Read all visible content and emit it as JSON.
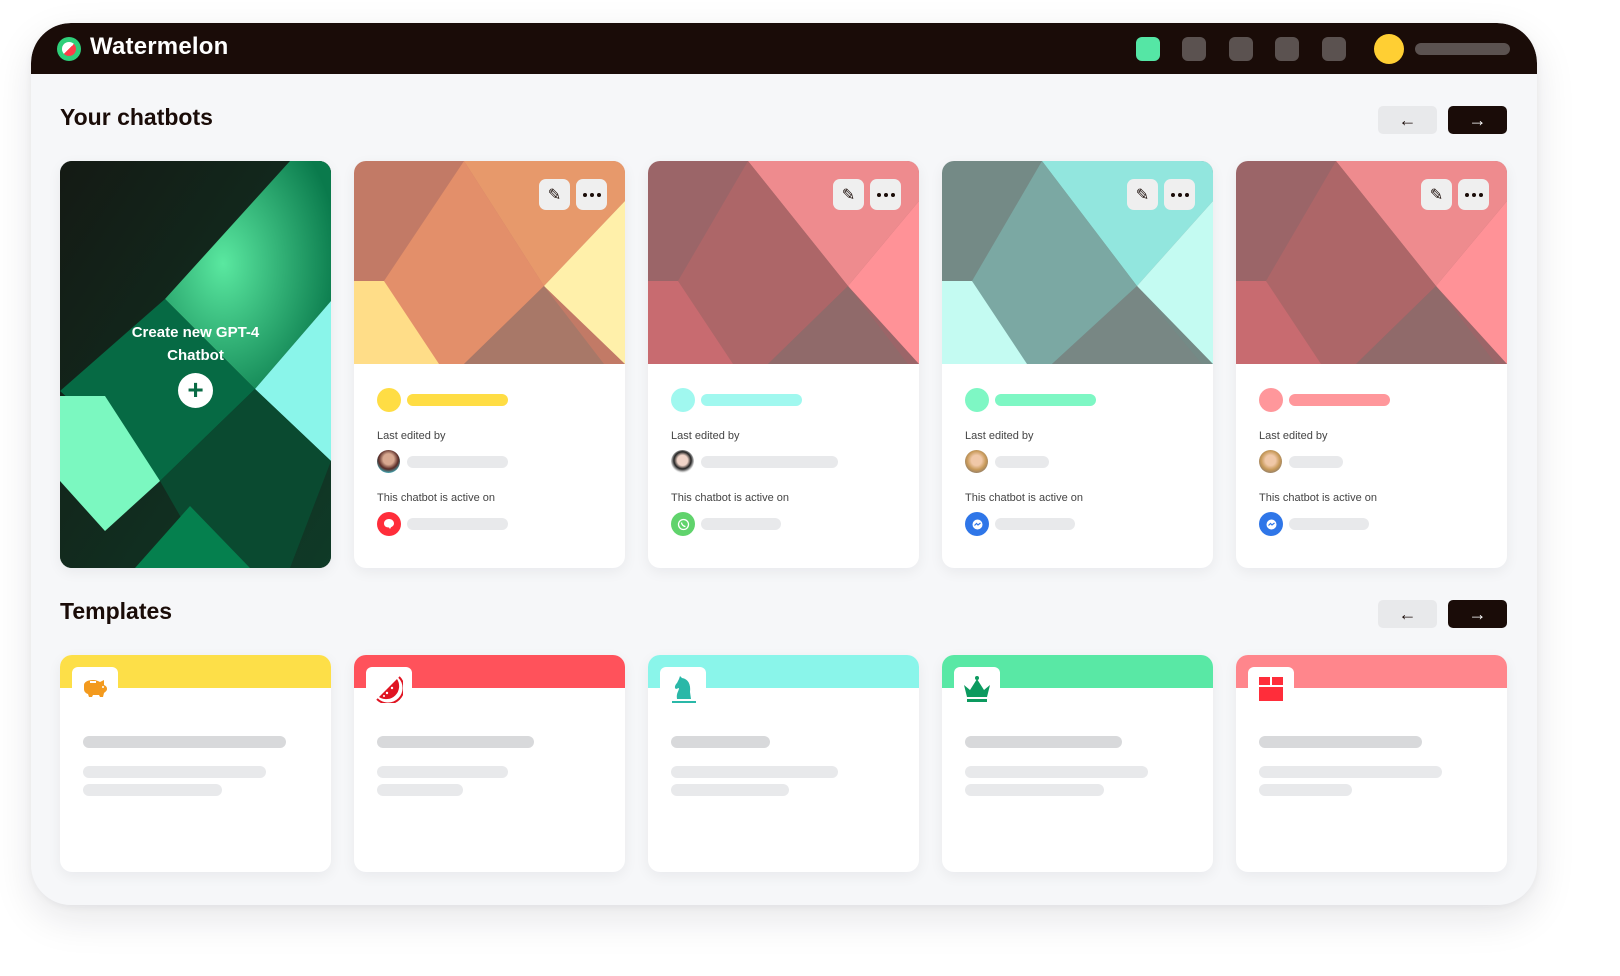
{
  "app": {
    "brand": "Watermelon",
    "nav_items": [
      {
        "name": "nav-item-1",
        "active": true
      },
      {
        "name": "nav-item-2",
        "active": false
      },
      {
        "name": "nav-item-3",
        "active": false
      },
      {
        "name": "nav-item-4",
        "active": false
      },
      {
        "name": "nav-item-5",
        "active": false
      }
    ],
    "colors": {
      "topbar": "#1a0c08",
      "accent_green": "#55e6a5",
      "user_avatar": "#ffcf33",
      "background": "#f6f7f9"
    }
  },
  "chatbots": {
    "title": "Your chatbots",
    "prev_label": "←",
    "next_label": "→",
    "create": {
      "line1": "Create new GPT-4",
      "line2": "Chatbot",
      "plus": "+"
    },
    "cards": [
      {
        "theme": "orange",
        "accent": "#ffdd44",
        "last_edited_label": "Last edited by",
        "active_on_label": "This chatbot is active on",
        "channel": "chat-bubble",
        "channel_color": "#ff2d3a",
        "avatar": "woman-curly-hair"
      },
      {
        "theme": "rose",
        "accent": "#a0f8ef",
        "last_edited_label": "Last edited by",
        "active_on_label": "This chatbot is active on",
        "channel": "whatsapp",
        "channel_color": "#60d36c",
        "avatar": "woman-bun"
      },
      {
        "theme": "teal",
        "accent": "#7ef7c4",
        "last_edited_label": "Last edited by",
        "active_on_label": "This chatbot is active on",
        "channel": "messenger",
        "channel_color": "#2f76e8",
        "avatar": "woman-blonde"
      },
      {
        "theme": "rose",
        "accent": "#ff979b",
        "last_edited_label": "Last edited by",
        "active_on_label": "This chatbot is active on",
        "channel": "messenger",
        "channel_color": "#2f76e8",
        "avatar": "woman-blonde"
      }
    ]
  },
  "templates": {
    "title": "Templates",
    "prev_label": "←",
    "next_label": "→",
    "items": [
      {
        "icon": "piggy-bank",
        "band_color": "#fddf48",
        "icon_color": "#f39a1e"
      },
      {
        "icon": "watermelon",
        "band_color": "#ff525b",
        "icon_color": "#e01422"
      },
      {
        "icon": "chess-knight",
        "band_color": "#8af5ea",
        "icon_color": "#2ab8a8"
      },
      {
        "icon": "crown",
        "band_color": "#59e8a5",
        "icon_color": "#0c9a5f"
      },
      {
        "icon": "gift-box",
        "band_color": "#ff868c",
        "icon_color": "#ff2d3a"
      }
    ]
  }
}
